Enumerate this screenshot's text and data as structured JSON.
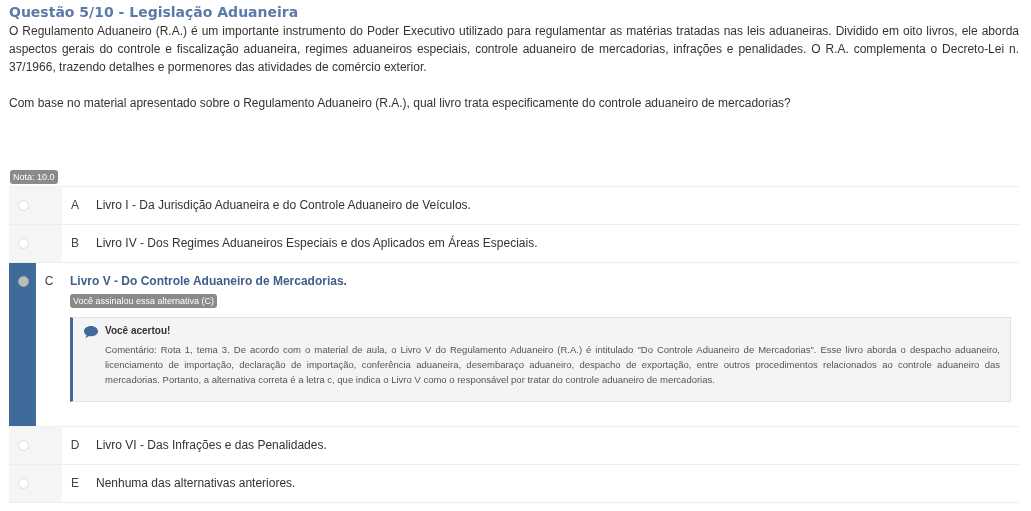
{
  "title": "Questão 5/10 - Legislação Aduaneira",
  "paragraphs": [
    "O Regulamento Aduaneiro (R.A.) é um importante instrumento do Poder Executivo utilizado para regulamentar as matérias tratadas nas leis aduaneiras. Dividido em oito livros, ele aborda aspectos gerais do controle e fiscalização aduaneira, regimes aduaneiros especiais, controle aduaneiro de mercadorias, infrações e penalidades. O R.A. complementa o Decreto-Lei n. 37/1966, trazendo detalhes e pormenores das atividades de comércio exterior.",
    "Com base no material apresentado sobre o Regulamento Aduaneiro (R.A.), qual livro trata especificamente do controle aduaneiro de mercadorias?"
  ],
  "grade": "Nota: 10.0",
  "options": [
    {
      "letter": "A",
      "text": "Livro I - Da Jurisdição Aduaneira e do Controle Aduaneiro de Veículos.",
      "selected": false
    },
    {
      "letter": "B",
      "text": "Livro IV - Dos Regimes Aduaneiros Especiais e dos Aplicados em Áreas Especiais.",
      "selected": false
    },
    {
      "letter": "C",
      "text": "Livro V - Do Controle Aduaneiro de Mercadorias.",
      "selected": true,
      "badge": "Você assinalou essa alternativa (C)",
      "feedback": {
        "title": "Você acertou!",
        "text": "Comentário: Rota 1, tema 3. De acordo com o material de aula, o Livro V do Regulamento Aduaneiro (R.A.) é intitulado \"Do Controle Aduaneiro de Mercadorias\". Esse livro aborda o despacho aduaneiro, licenciamento de importação, declaração de importação, conferência aduaneira, desembaraço aduaneiro, despacho de exportação, entre outros procedimentos relacionados ao controle aduaneiro das mercadorias. Portanto, a alternativa correta é a letra c, que indica o Livro V como o responsável por tratar do controle aduaneiro de mercadorias."
      }
    },
    {
      "letter": "D",
      "text": "Livro VI - Das Infrações e das Penalidades.",
      "selected": false
    },
    {
      "letter": "E",
      "text": "Nenhuma das alternativas anteriores.",
      "selected": false
    }
  ]
}
